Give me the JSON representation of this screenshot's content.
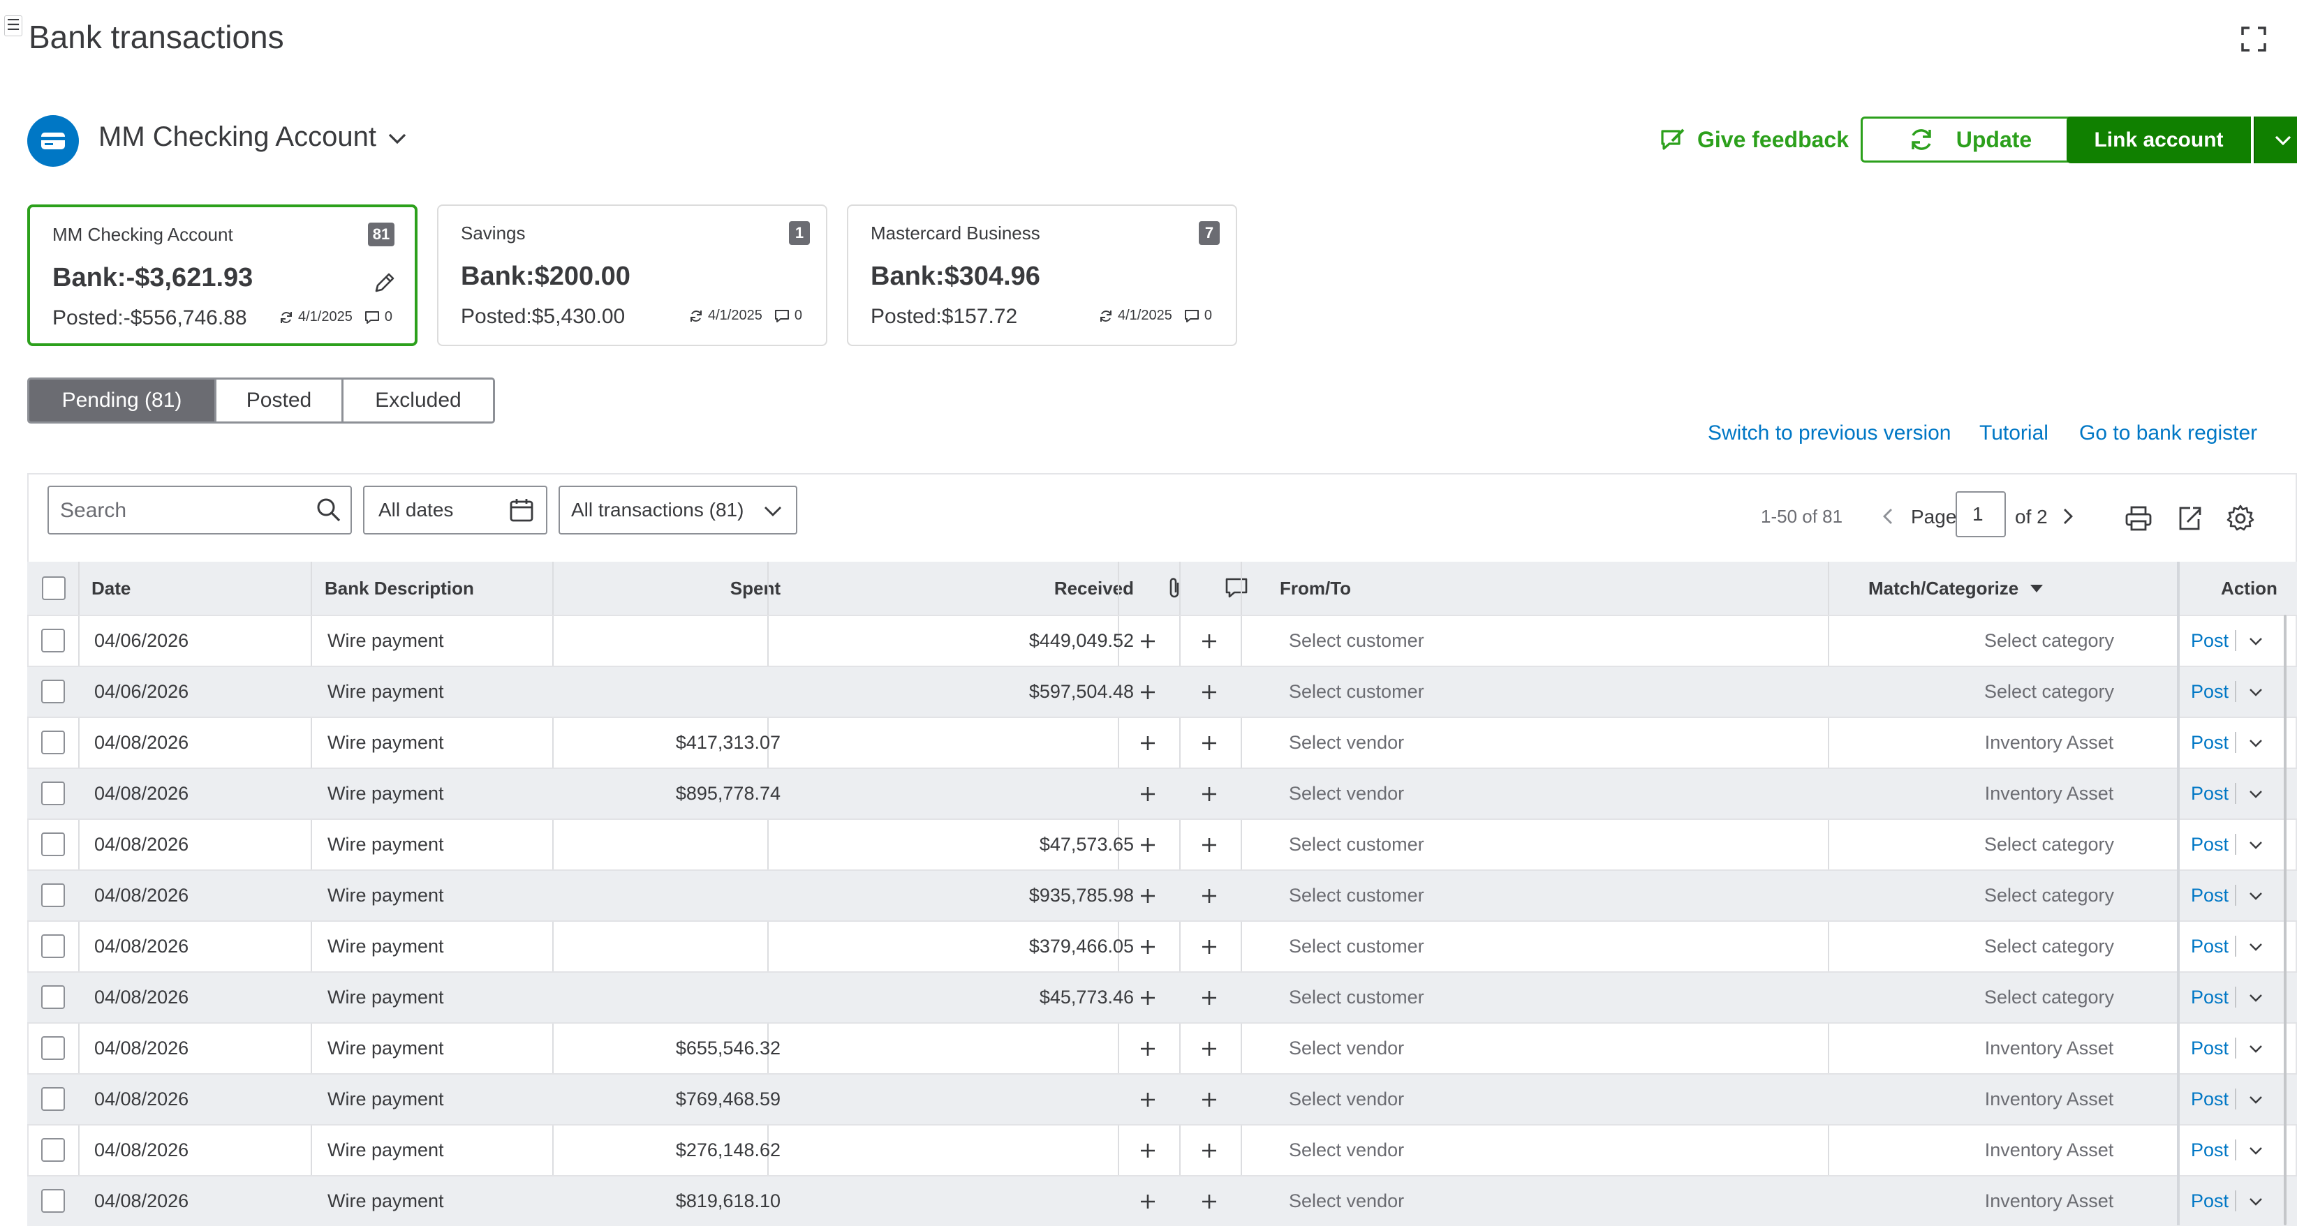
{
  "page": {
    "title": "Bank transactions",
    "menu_glyph": "☰"
  },
  "account": {
    "selected_name": "MM Checking Account",
    "icon": "bank-card-icon",
    "accent_color": "#0077c5"
  },
  "header_actions": {
    "feedback_label": "Give feedback",
    "update_label": "Update",
    "link_account_label": "Link account"
  },
  "cards": [
    {
      "name": "MM Checking Account",
      "badge": "81",
      "bank": "Bank:-$3,621.93",
      "posted": "Posted:-$556,746.88",
      "date": "4/1/2025",
      "comments": "0",
      "selected": true
    },
    {
      "name": "Savings",
      "badge": "1",
      "bank": "Bank:$200.00",
      "posted": "Posted:$5,430.00",
      "date": "4/1/2025",
      "comments": "0",
      "selected": false
    },
    {
      "name": "Mastercard Business",
      "badge": "7",
      "bank": "Bank:$304.96",
      "posted": "Posted:$157.72",
      "date": "4/1/2025",
      "comments": "0",
      "selected": false
    }
  ],
  "tabs": [
    {
      "label": "Pending (81)",
      "active": true
    },
    {
      "label": "Posted",
      "active": false
    },
    {
      "label": "Excluded",
      "active": false
    }
  ],
  "links": {
    "switch_version": "Switch to previous version",
    "tutorial": "Tutorial",
    "bank_register": "Go to bank register"
  },
  "filters": {
    "search_placeholder": "Search",
    "dates_label": "All dates",
    "transactions_label": "All transactions (81)"
  },
  "pager": {
    "range": "1-50 of 81",
    "page_label": "Page",
    "page_value": "1",
    "of_label": "of 2"
  },
  "columns": {
    "date": "Date",
    "description": "Bank Description",
    "spent": "Spent",
    "received": "Received",
    "attachment_icon": "paperclip-icon",
    "comment_icon": "comment-icon",
    "from_to": "From/To",
    "match": "Match/Categorize",
    "action": "Action"
  },
  "rows": [
    {
      "date": "04/06/2026",
      "description": "Wire payment",
      "spent": "",
      "received": "$449,049.52",
      "from_to": "Select customer",
      "category": "Select category",
      "action": "Post"
    },
    {
      "date": "04/06/2026",
      "description": "Wire payment",
      "spent": "",
      "received": "$597,504.48",
      "from_to": "Select customer",
      "category": "Select category",
      "action": "Post"
    },
    {
      "date": "04/08/2026",
      "description": "Wire payment",
      "spent": "$417,313.07",
      "received": "",
      "from_to": "Select vendor",
      "category": "Inventory Asset",
      "action": "Post"
    },
    {
      "date": "04/08/2026",
      "description": "Wire payment",
      "spent": "$895,778.74",
      "received": "",
      "from_to": "Select vendor",
      "category": "Inventory Asset",
      "action": "Post"
    },
    {
      "date": "04/08/2026",
      "description": "Wire payment",
      "spent": "",
      "received": "$47,573.65",
      "from_to": "Select customer",
      "category": "Select category",
      "action": "Post"
    },
    {
      "date": "04/08/2026",
      "description": "Wire payment",
      "spent": "",
      "received": "$935,785.98",
      "from_to": "Select customer",
      "category": "Select category",
      "action": "Post"
    },
    {
      "date": "04/08/2026",
      "description": "Wire payment",
      "spent": "",
      "received": "$379,466.05",
      "from_to": "Select customer",
      "category": "Select category",
      "action": "Post"
    },
    {
      "date": "04/08/2026",
      "description": "Wire payment",
      "spent": "",
      "received": "$45,773.46",
      "from_to": "Select customer",
      "category": "Select category",
      "action": "Post"
    },
    {
      "date": "04/08/2026",
      "description": "Wire payment",
      "spent": "$655,546.32",
      "received": "",
      "from_to": "Select vendor",
      "category": "Inventory Asset",
      "action": "Post"
    },
    {
      "date": "04/08/2026",
      "description": "Wire payment",
      "spent": "$769,468.59",
      "received": "",
      "from_to": "Select vendor",
      "category": "Inventory Asset",
      "action": "Post"
    },
    {
      "date": "04/08/2026",
      "description": "Wire payment",
      "spent": "$276,148.62",
      "received": "",
      "from_to": "Select vendor",
      "category": "Inventory Asset",
      "action": "Post"
    },
    {
      "date": "04/08/2026",
      "description": "Wire payment",
      "spent": "$819,618.10",
      "received": "",
      "from_to": "Select vendor",
      "category": "Inventory Asset",
      "action": "Post"
    }
  ],
  "colors": {
    "brand_green": "#2ca01c",
    "button_green": "#108000",
    "link_blue": "#0077c5",
    "active_tab": "#6b6c72"
  }
}
